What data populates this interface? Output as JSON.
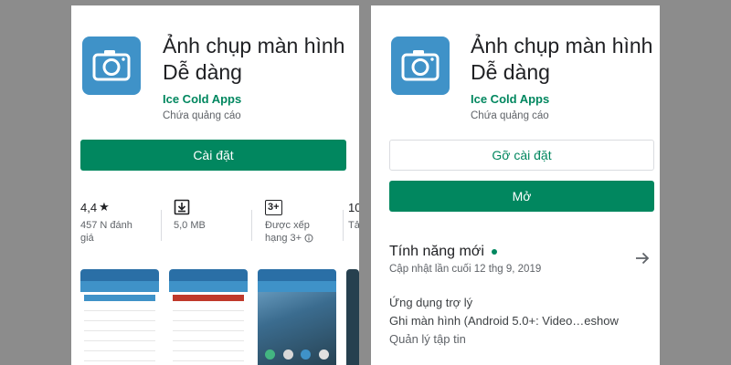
{
  "app": {
    "title_line1": "Ảnh chụp màn hình",
    "title_line2": "Dễ dàng",
    "developer": "Ice Cold Apps",
    "ads_note": "Chứa quảng cáo"
  },
  "left": {
    "install_label": "Cài đặt",
    "stats": {
      "rating_value": "4,4",
      "rating_star": "★",
      "rating_count": "457 N đánh",
      "rating_count_2": "giá",
      "size": "5,0 MB",
      "content_badge": "3+",
      "content_line1": "Được xếp",
      "content_line2": "hạng 3+",
      "extra_top": "10",
      "extra_sub": "Tả"
    }
  },
  "right": {
    "uninstall_label": "Gỡ cài đặt",
    "open_label": "Mở",
    "whats_new_title": "Tính năng mới",
    "updated": "Cập nhật lần cuối 12 thg 9, 2019",
    "news_lines": [
      "Ứng dụng trợ lý",
      "Ghi màn hình (Android 5.0+: Video…eshow",
      "Quản lý tập tin"
    ]
  },
  "colors": {
    "accent": "#01875f",
    "icon_bg": "#3f92c8",
    "backdrop": "#8c8c8c"
  },
  "icons": [
    "camera-icon",
    "star-icon",
    "download-icon",
    "info-icon",
    "arrow-right-icon"
  ]
}
